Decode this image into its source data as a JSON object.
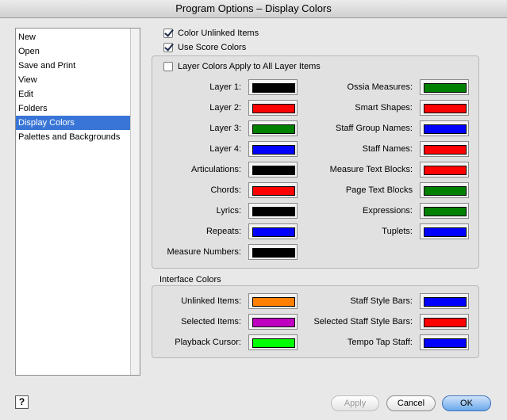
{
  "window": {
    "title": "Program Options – Display Colors"
  },
  "sidebar": {
    "items": [
      {
        "label": "New"
      },
      {
        "label": "Open"
      },
      {
        "label": "Save and Print"
      },
      {
        "label": "View"
      },
      {
        "label": "Edit"
      },
      {
        "label": "Folders"
      },
      {
        "label": "Display Colors",
        "selected": true
      },
      {
        "label": "Palettes and Backgrounds"
      }
    ]
  },
  "options": {
    "color_unlinked": {
      "label": "Color Unlinked Items",
      "checked": true
    },
    "use_score": {
      "label": "Use Score Colors",
      "checked": true
    }
  },
  "layer_group": {
    "apply_all": {
      "label": "Layer Colors Apply to All Layer Items",
      "checked": false
    },
    "left": [
      {
        "label": "Layer 1:",
        "color": "#000000"
      },
      {
        "label": "Layer 2:",
        "color": "#ff0000"
      },
      {
        "label": "Layer 3:",
        "color": "#008000"
      },
      {
        "label": "Layer 4:",
        "color": "#0000ff"
      },
      {
        "label": "Articulations:",
        "color": "#000000"
      },
      {
        "label": "Chords:",
        "color": "#ff0000"
      },
      {
        "label": "Lyrics:",
        "color": "#000000"
      },
      {
        "label": "Repeats:",
        "color": "#0000ff"
      },
      {
        "label": "Measure Numbers:",
        "color": "#000000"
      }
    ],
    "right": [
      {
        "label": "Ossia Measures:",
        "color": "#008000"
      },
      {
        "label": "Smart Shapes:",
        "color": "#ff0000"
      },
      {
        "label": "Staff Group Names:",
        "color": "#0000ff"
      },
      {
        "label": "Staff Names:",
        "color": "#ff0000"
      },
      {
        "label": "Measure Text Blocks:",
        "color": "#ff0000"
      },
      {
        "label": "Page Text Blocks",
        "color": "#008000"
      },
      {
        "label": "Expressions:",
        "color": "#008000"
      },
      {
        "label": "Tuplets:",
        "color": "#0000ff"
      }
    ]
  },
  "interface_group": {
    "title": "Interface Colors",
    "left": [
      {
        "label": "Unlinked Items:",
        "color": "#ff8000"
      },
      {
        "label": "Selected Items:",
        "color": "#c000c0"
      },
      {
        "label": "Playback Cursor:",
        "color": "#00ff00"
      }
    ],
    "right": [
      {
        "label": "Staff Style Bars:",
        "color": "#0000ff"
      },
      {
        "label": "Selected Staff Style Bars:",
        "color": "#ff0000"
      },
      {
        "label": "Tempo Tap Staff:",
        "color": "#0000ff"
      }
    ]
  },
  "buttons": {
    "help": "?",
    "apply": "Apply",
    "cancel": "Cancel",
    "ok": "OK"
  }
}
